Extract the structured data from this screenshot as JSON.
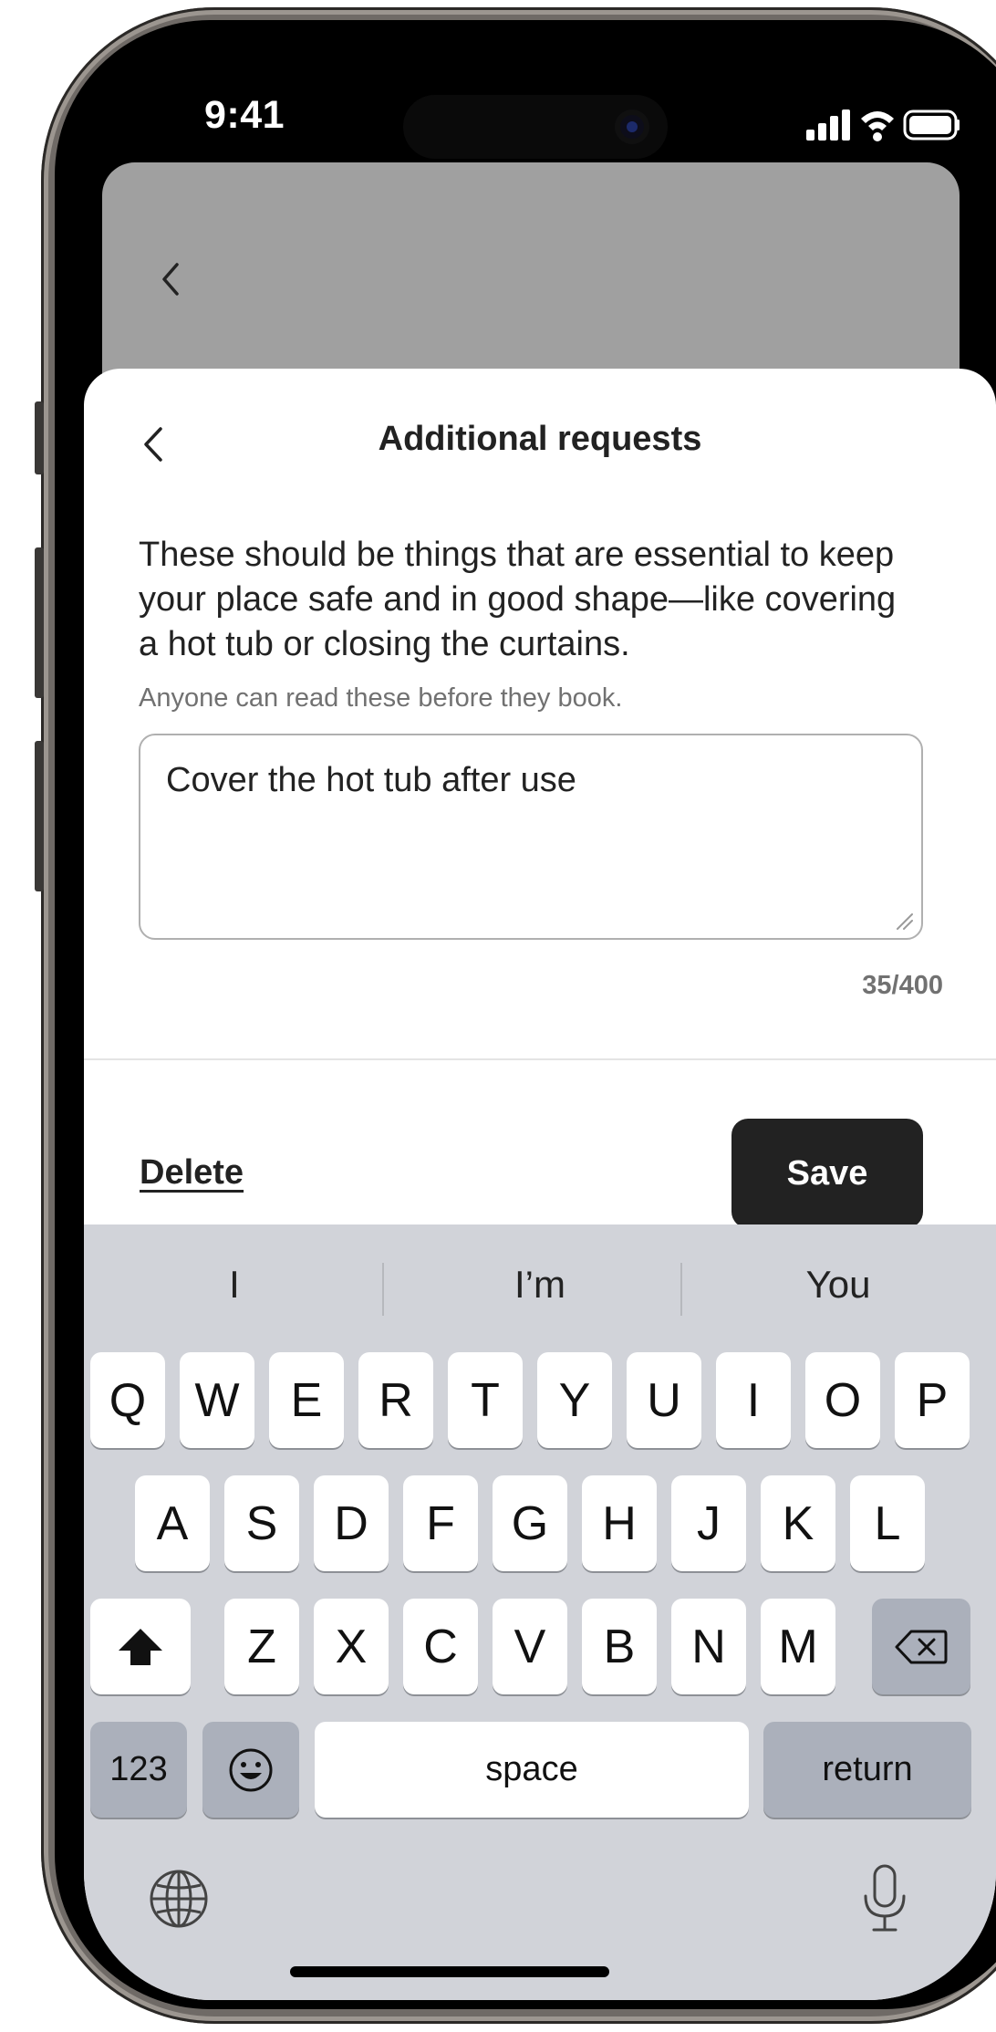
{
  "status_bar": {
    "time": "9:41"
  },
  "header": {
    "title": "Additional requests"
  },
  "content": {
    "description": "These should be things that are essential to keep your place safe and in good shape—like covering a hot tub or closing the curtains.",
    "hint": "Anyone can read these before they book.",
    "textarea_value": "Cover the hot tub after use",
    "char_count": "35/400"
  },
  "actions": {
    "delete_label": "Delete",
    "save_label": "Save"
  },
  "keyboard": {
    "suggestions": [
      "I",
      "I’m",
      "You"
    ],
    "row1": [
      "Q",
      "W",
      "E",
      "R",
      "T",
      "Y",
      "U",
      "I",
      "O",
      "P"
    ],
    "row2": [
      "A",
      "S",
      "D",
      "F",
      "G",
      "H",
      "J",
      "K",
      "L"
    ],
    "row3": [
      "Z",
      "X",
      "C",
      "V",
      "B",
      "N",
      "M"
    ],
    "numbers_label": "123",
    "space_label": "space",
    "return_label": "return"
  },
  "icons": [
    "back-chevron-icon",
    "signal-icon",
    "wifi-icon",
    "battery-icon",
    "shift-icon",
    "backspace-icon",
    "emoji-icon",
    "globe-icon",
    "microphone-icon"
  ],
  "colors": {
    "primary_button": "#222222",
    "sheet_bg": "#ffffff",
    "keyboard_bg": "#d1d3d9",
    "muted_text": "#717171"
  }
}
